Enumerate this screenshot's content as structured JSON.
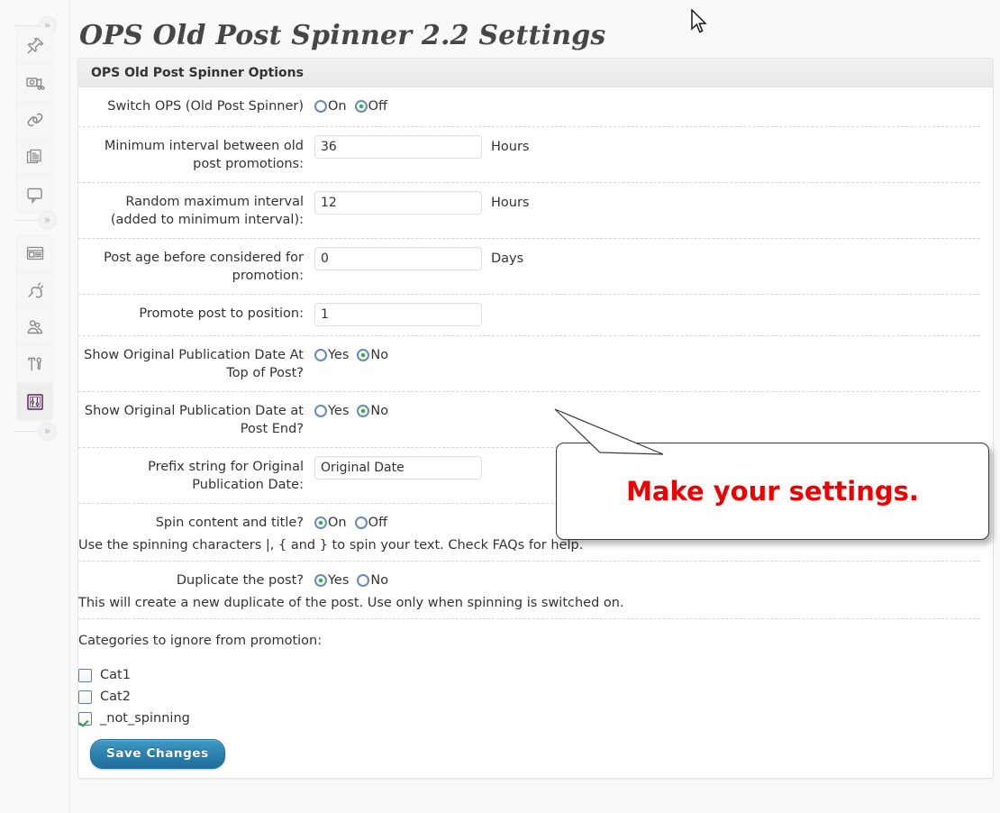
{
  "page": {
    "title": "OPS Old Post Spinner 2.2 Settings"
  },
  "sidebar": {
    "separator_glyph": "»",
    "groups": [
      {
        "items": [
          {
            "icon": "pin-icon",
            "name": "sidebar-item-posts"
          },
          {
            "icon": "media-camera-icon",
            "name": "sidebar-item-media"
          },
          {
            "icon": "link-chain-icon",
            "name": "sidebar-item-links"
          },
          {
            "icon": "pages-copy-icon",
            "name": "sidebar-item-pages"
          },
          {
            "icon": "comment-bubble-icon",
            "name": "sidebar-item-comments"
          }
        ]
      },
      {
        "items": [
          {
            "icon": "appearance-panel-icon",
            "name": "sidebar-item-appearance"
          },
          {
            "icon": "plug-icon",
            "name": "sidebar-item-plugins"
          },
          {
            "icon": "users-icon",
            "name": "sidebar-item-users"
          },
          {
            "icon": "tools-icon",
            "name": "sidebar-item-tools"
          },
          {
            "icon": "settings-sliders-icon",
            "name": "sidebar-item-settings",
            "current": true
          }
        ]
      }
    ]
  },
  "panel": {
    "header_title": "OPS Old Post Spinner Options",
    "rows": [
      {
        "type": "radio",
        "label": "Switch OPS (Old Post Spinner)",
        "options": [
          {
            "label": "On",
            "checked": false
          },
          {
            "label": "Off",
            "checked": true
          }
        ]
      },
      {
        "type": "text",
        "label": "Minimum interval between old post promotions:",
        "value": "36",
        "unit": "Hours"
      },
      {
        "type": "text",
        "label": "Random maximum interval (added to minimum interval):",
        "value": "12",
        "unit": "Hours"
      },
      {
        "type": "text",
        "label": "Post age before considered for promotion:",
        "value": "0",
        "unit": "Days"
      },
      {
        "type": "text",
        "label": "Promote post to position:",
        "value": "1",
        "unit": ""
      },
      {
        "type": "radio",
        "label": "Show Original Publication Date At Top of Post?",
        "options": [
          {
            "label": "Yes",
            "checked": false
          },
          {
            "label": "No",
            "checked": true
          }
        ]
      },
      {
        "type": "radio",
        "label": "Show Original Publication Date at Post End?",
        "options": [
          {
            "label": "Yes",
            "checked": false
          },
          {
            "label": "No",
            "checked": true
          }
        ]
      },
      {
        "type": "text",
        "label": "Prefix string for Original Publication Date:",
        "value": "Original Date",
        "unit": ""
      },
      {
        "type": "radio",
        "label": "Spin content and title?",
        "options": [
          {
            "label": "On",
            "checked": true
          },
          {
            "label": "Off",
            "checked": false
          }
        ],
        "help": "Use the spinning characters |, { and } to spin your text. Check FAQs for help."
      },
      {
        "type": "radio",
        "label": "Duplicate the post?",
        "options": [
          {
            "label": "Yes",
            "checked": true
          },
          {
            "label": "No",
            "checked": false
          }
        ],
        "help": "This will create a new duplicate of the post. Use only when spinning is switched on."
      }
    ],
    "categories": {
      "title": "Categories to ignore from promotion:",
      "items": [
        {
          "label": "Cat1",
          "checked": false
        },
        {
          "label": "Cat2",
          "checked": false
        },
        {
          "label": "_not_spinning",
          "checked": true
        }
      ]
    },
    "save_label": "Save Changes"
  },
  "annotation": {
    "text": "Make your settings.",
    "color": "#ef0000"
  },
  "colors": {
    "accent_button": "#2e82ad",
    "radio_border": "#6a8bb5",
    "radio_dot": "#2bb24c",
    "checkbox_check": "#2f9e3f",
    "page_bg": "#f9f9f9",
    "panel_header_bg": "#ececec",
    "annotation_red": "#ef0000"
  }
}
